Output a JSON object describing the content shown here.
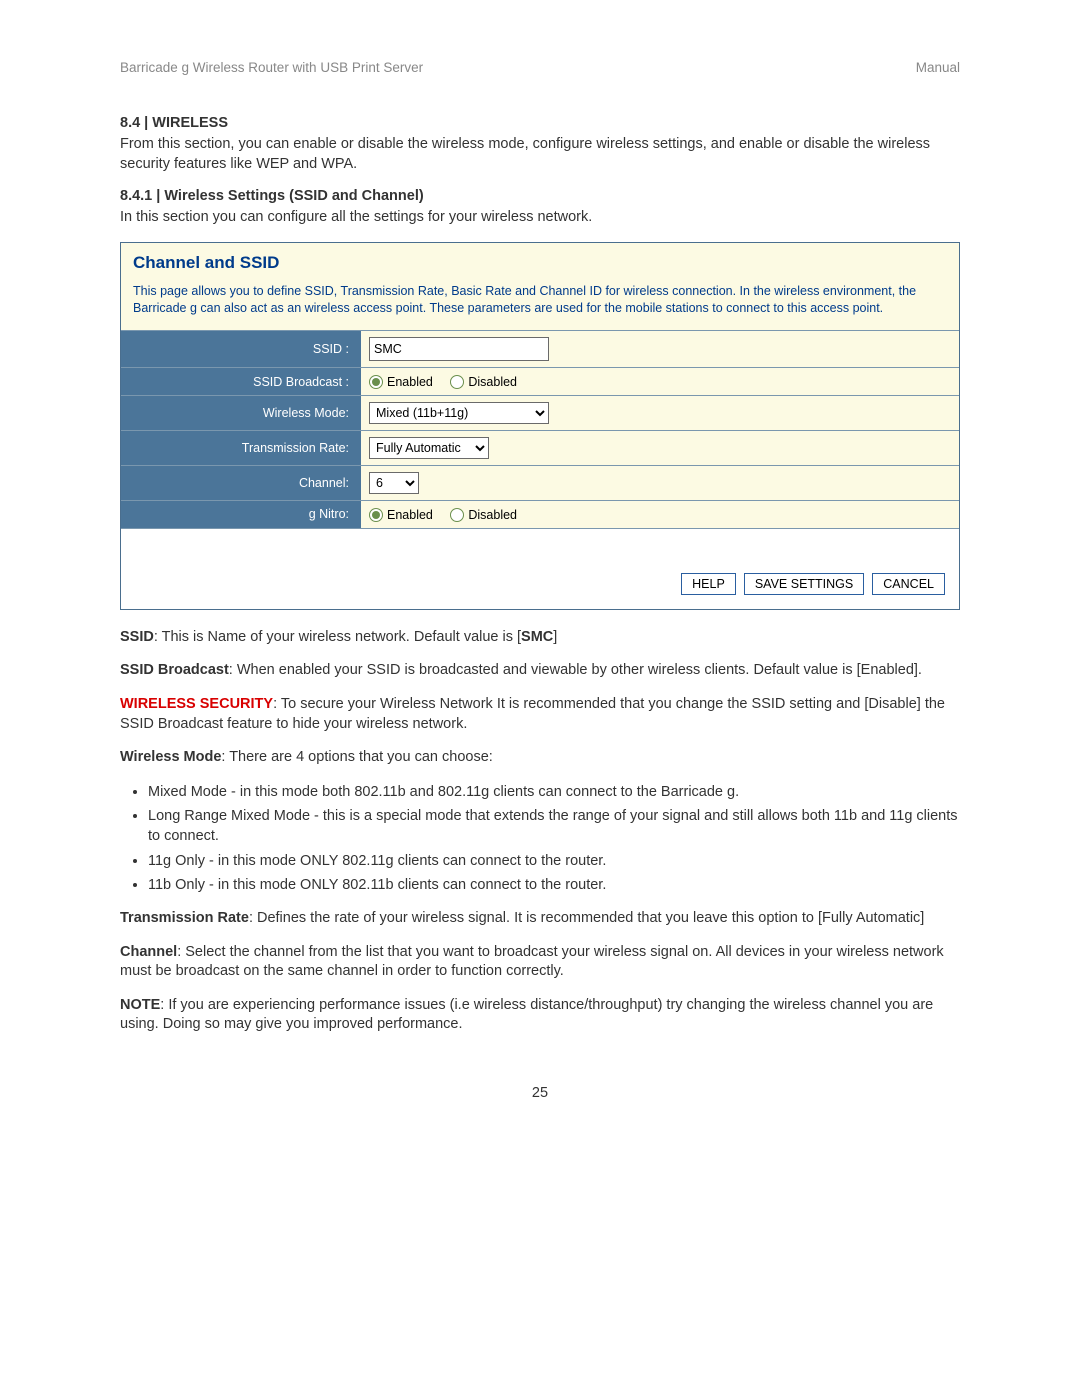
{
  "header": {
    "left": "Barricade g Wireless Router with USB Print Server",
    "right": "Manual"
  },
  "sec84": {
    "title": "8.4 | WIRELESS",
    "body": "From this section, you can enable or disable the wireless mode, configure wireless settings, and enable or disable the wireless security features like WEP and WPA."
  },
  "sec841": {
    "title": "8.4.1 | Wireless Settings (SSID and Channel)",
    "body": "In this section you can configure all the settings for your wireless network."
  },
  "panel": {
    "title": "Channel and SSID",
    "desc": "This page allows you to define SSID, Transmission Rate, Basic Rate and Channel ID for wireless connection.  In the wireless environment, the Barricade g can also act as an wireless access point.  These parameters are used for the mobile stations to connect to this access point.",
    "rows": {
      "ssid": {
        "label": "SSID :",
        "value": "SMC"
      },
      "broadcast": {
        "label": "SSID Broadcast :",
        "enabled": "Enabled",
        "disabled": "Disabled"
      },
      "mode": {
        "label": "Wireless Mode:",
        "value": "Mixed (11b+11g)"
      },
      "rate": {
        "label": "Transmission Rate:",
        "value": "Fully Automatic"
      },
      "channel": {
        "label": "Channel:",
        "value": "6"
      },
      "nitro": {
        "label": "g Nitro:",
        "enabled": "Enabled",
        "disabled": "Disabled"
      }
    },
    "buttons": {
      "help": "HELP",
      "save": "SAVE SETTINGS",
      "cancel": "CANCEL"
    }
  },
  "desc": {
    "ssid_l": "SSID",
    "ssid_t": ": This is Name of your wireless network. Default value is [",
    "ssid_v": "SMC",
    "ssid_e": "]",
    "bcast_l": "SSID Broadcast",
    "bcast_t": ": When enabled your SSID is broadcasted and viewable by other wireless clients. Default value is [Enabled].",
    "sec_l": "WIRELESS SECURITY",
    "sec_t": ": To secure your Wireless Network It is recommended that you change the SSID setting and [Disable] the SSID Broadcast feature to hide your wireless network.",
    "mode_l": "Wireless Mode",
    "mode_t": ": There are 4 options that you can choose:",
    "modes": [
      "Mixed Mode - in this mode both 802.11b and 802.11g clients can connect to the Barricade g.",
      "Long Range Mixed Mode - this is a special mode that extends the range of your signal and still allows both 11b and 11g clients to connect.",
      "11g Only - in this mode ONLY 802.11g clients can connect to the router.",
      "11b Only - in this mode ONLY 802.11b clients can connect to the router."
    ],
    "rate_l": "Transmission Rate",
    "rate_t": ": Defines the rate of your wireless signal. It is recommended that you leave this option to [Fully Automatic]",
    "chan_l": "Channel",
    "chan_t": ": Select the channel from the list that you want to broadcast your wireless signal on. All devices in your wireless network must be broadcast on the same channel in order to function correctly.",
    "note_l": "NOTE",
    "note_t": ": If you are experiencing performance issues (i.e wireless distance/throughput) try changing the wireless channel you are using. Doing so may give you improved performance."
  },
  "page": "25"
}
